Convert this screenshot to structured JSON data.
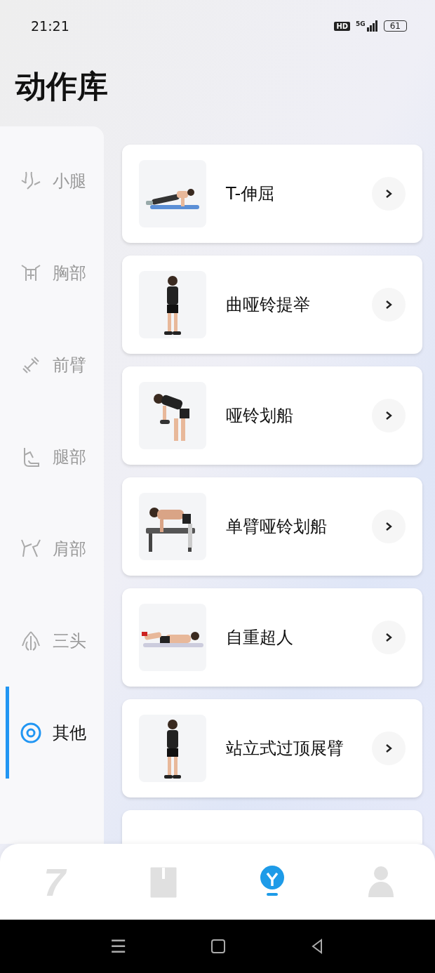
{
  "status_bar": {
    "time": "21:21",
    "hd": "HD",
    "network": "5G",
    "battery": "61"
  },
  "title": "动作库",
  "categories": [
    {
      "label": "小腿",
      "selected": false
    },
    {
      "label": "胸部",
      "selected": false
    },
    {
      "label": "前臂",
      "selected": false
    },
    {
      "label": "腿部",
      "selected": false
    },
    {
      "label": "肩部",
      "selected": false
    },
    {
      "label": "三头",
      "selected": false
    },
    {
      "label": "其他",
      "selected": true
    }
  ],
  "exercises": [
    {
      "name": "T-伸屈",
      "kind": "plank"
    },
    {
      "name": "曲哑铃提举",
      "kind": "standing"
    },
    {
      "name": "哑铃划船",
      "kind": "bent"
    },
    {
      "name": "单臂哑铃划船",
      "kind": "bench"
    },
    {
      "name": "自重超人",
      "kind": "lying"
    },
    {
      "name": "站立式过顶展臂",
      "kind": "standing"
    },
    {
      "kind": "hidden"
    }
  ],
  "bottom_nav": [
    {
      "glyph": "7",
      "selected": false
    },
    {
      "selected": false
    },
    {
      "selected": true
    },
    {
      "selected": false
    }
  ],
  "system_nav": {
    "menu": "☰"
  }
}
